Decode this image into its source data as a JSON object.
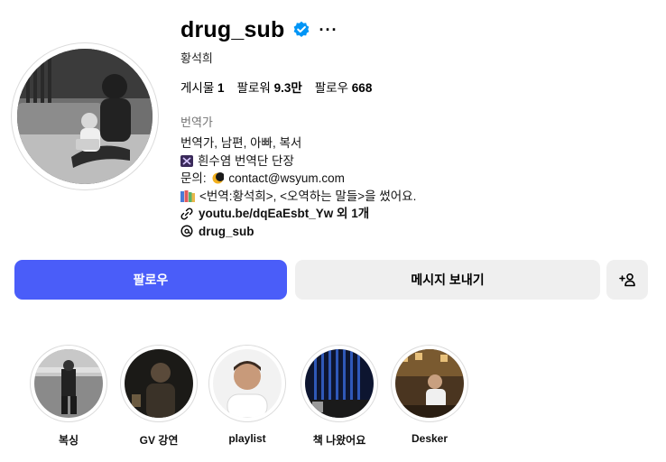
{
  "profile": {
    "username": "drug_sub",
    "full_name": "황석희",
    "verified_icon": "verified-badge-icon",
    "more_icon": "more-options-icon",
    "stats": {
      "posts_label": "게시물",
      "posts_value": "1",
      "followers_label": "팔로워",
      "followers_value": "9.3만",
      "following_label": "팔로우",
      "following_value": "668"
    },
    "category": "번역가",
    "bio": {
      "line1": "번역가, 남편, 아빠, 복서",
      "line2": "흰수염 번역단 단장",
      "line3_prefix": "문의:",
      "line3_email": "contact@wsyum.com",
      "line4": "<번역:황석희>, <오역하는 말들>을 썼어요."
    },
    "link_text": "youtu.be/dqEaEsbt_Yw 외 1개",
    "threads_handle": "drug_sub"
  },
  "actions": {
    "follow_label": "팔로우",
    "message_label": "메시지 보내기",
    "suggest_icon": "add-person-icon"
  },
  "highlights": [
    {
      "label": "복싱"
    },
    {
      "label": "GV 강연"
    },
    {
      "label": "playlist"
    },
    {
      "label": "책 나왔어요"
    },
    {
      "label": "Desker"
    }
  ],
  "colors": {
    "follow_button": "#4a5df9",
    "secondary_button": "#efefef",
    "verified_badge": "#0095f6",
    "muted_text": "#737373"
  }
}
